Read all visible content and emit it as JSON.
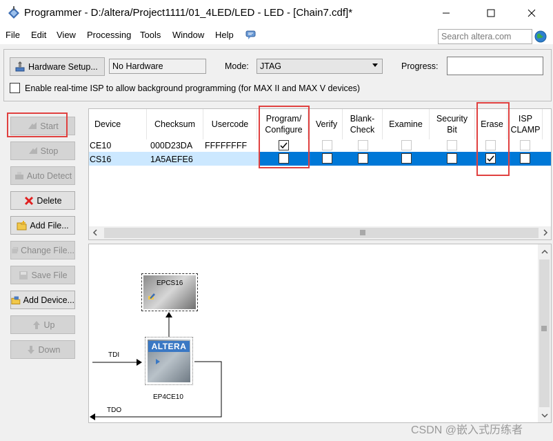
{
  "window": {
    "title": "Programmer - D:/altera/Project1111/01_4LED/LED - LED - [Chain7.cdf]*",
    "minimize_icon": "minimize-icon",
    "maximize_icon": "maximize-icon",
    "close_icon": "close-icon"
  },
  "menu": [
    "File",
    "Edit",
    "View",
    "Processing",
    "Tools",
    "Window",
    "Help"
  ],
  "search": {
    "placeholder": "Search altera.com"
  },
  "toolbar": {
    "hardware_setup": "Hardware Setup...",
    "hardware_value": "No Hardware",
    "mode_label": "Mode:",
    "mode_value": "JTAG",
    "progress_label": "Progress:",
    "isp_label": "Enable real-time ISP to allow background programming (for MAX II and MAX V devices)",
    "isp_checked": false
  },
  "side_buttons": [
    {
      "label": "Start",
      "enabled": false
    },
    {
      "label": "Stop",
      "enabled": false
    },
    {
      "label": "Auto Detect",
      "enabled": false
    },
    {
      "label": "Delete",
      "enabled": true
    },
    {
      "label": "Add File...",
      "enabled": true
    },
    {
      "label": "Change File...",
      "enabled": false
    },
    {
      "label": "Save File",
      "enabled": false
    },
    {
      "label": "Add Device...",
      "enabled": true
    },
    {
      "label": "Up",
      "enabled": false
    },
    {
      "label": "Down",
      "enabled": false
    }
  ],
  "table": {
    "columns": [
      "Device",
      "Checksum",
      "Usercode",
      "Program/\nConfigure",
      "Verify",
      "Blank-\nCheck",
      "Examine",
      "Security\nBit",
      "Erase",
      "ISP\nCLAMP"
    ],
    "rows": [
      {
        "device": "CE10",
        "checksum": "000D23DA",
        "usercode": "FFFFFFFF",
        "program": true,
        "verify": false,
        "blank": false,
        "examine": false,
        "security": false,
        "erase": false,
        "isp": false,
        "selected": false
      },
      {
        "device": "CS16",
        "checksum": "1A5AEFE6",
        "usercode": "",
        "program": false,
        "verify": false,
        "blank": false,
        "examine": false,
        "security": false,
        "erase": true,
        "isp": false,
        "selected": true
      }
    ]
  },
  "diagram": {
    "epcs_label": "EPCS16",
    "fpga_label": "EP4CE10",
    "fpga_brand": "ALTERA",
    "tdi_label": "TDI",
    "tdo_label": "TDO"
  },
  "watermark": "CSDN @嵌入式历练者",
  "colors": {
    "selection": "#0078d7",
    "highlight": "#e0403f"
  }
}
